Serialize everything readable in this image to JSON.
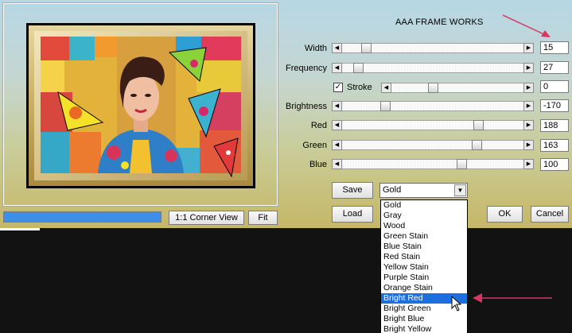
{
  "dialog": {
    "title": "AAA FRAME WORKS"
  },
  "sliders": [
    {
      "label": "Width",
      "value": "15",
      "level": 0.11
    },
    {
      "label": "Frequency",
      "value": "27",
      "level": 0.06
    },
    {
      "label": "Stroke",
      "value": "0",
      "level": 0.3,
      "checked": true
    },
    {
      "label": "Brightness",
      "value": "-170",
      "level": 0.22
    },
    {
      "label": "Red",
      "value": "188",
      "level": 0.77
    },
    {
      "label": "Green",
      "value": "163",
      "level": 0.76
    },
    {
      "label": "Blue",
      "value": "100",
      "level": 0.67
    }
  ],
  "buttons": {
    "corner_view": "1:1 Corner View",
    "fit": "Fit",
    "save": "Save",
    "load": "Load",
    "ok": "OK",
    "cancel": "Cancel"
  },
  "progress": {
    "level": 1.0
  },
  "preset": {
    "selected": "Gold",
    "options": [
      "Gold",
      "Gray",
      "Wood",
      "Green Stain",
      "Blue Stain",
      "Red Stain",
      "Yellow Stain",
      "Purple Stain",
      "Orange Stain",
      "Bright Red",
      "Bright Green",
      "Bright Blue",
      "Bright Yellow"
    ],
    "highlighted": "Bright Red"
  },
  "colors": {
    "arrow": "#d63663",
    "highlight": "#1e6ede",
    "progress": "#3c90ec",
    "frame_gold": "#d9c58a",
    "frame_inner_black": "#000000"
  },
  "icons": {
    "checkbox_check": "check-icon",
    "slider_left": "arrow-left-icon",
    "slider_right": "arrow-right-icon",
    "dropdown": "chevron-down-icon",
    "cursor": "mouse-pointer-icon"
  }
}
